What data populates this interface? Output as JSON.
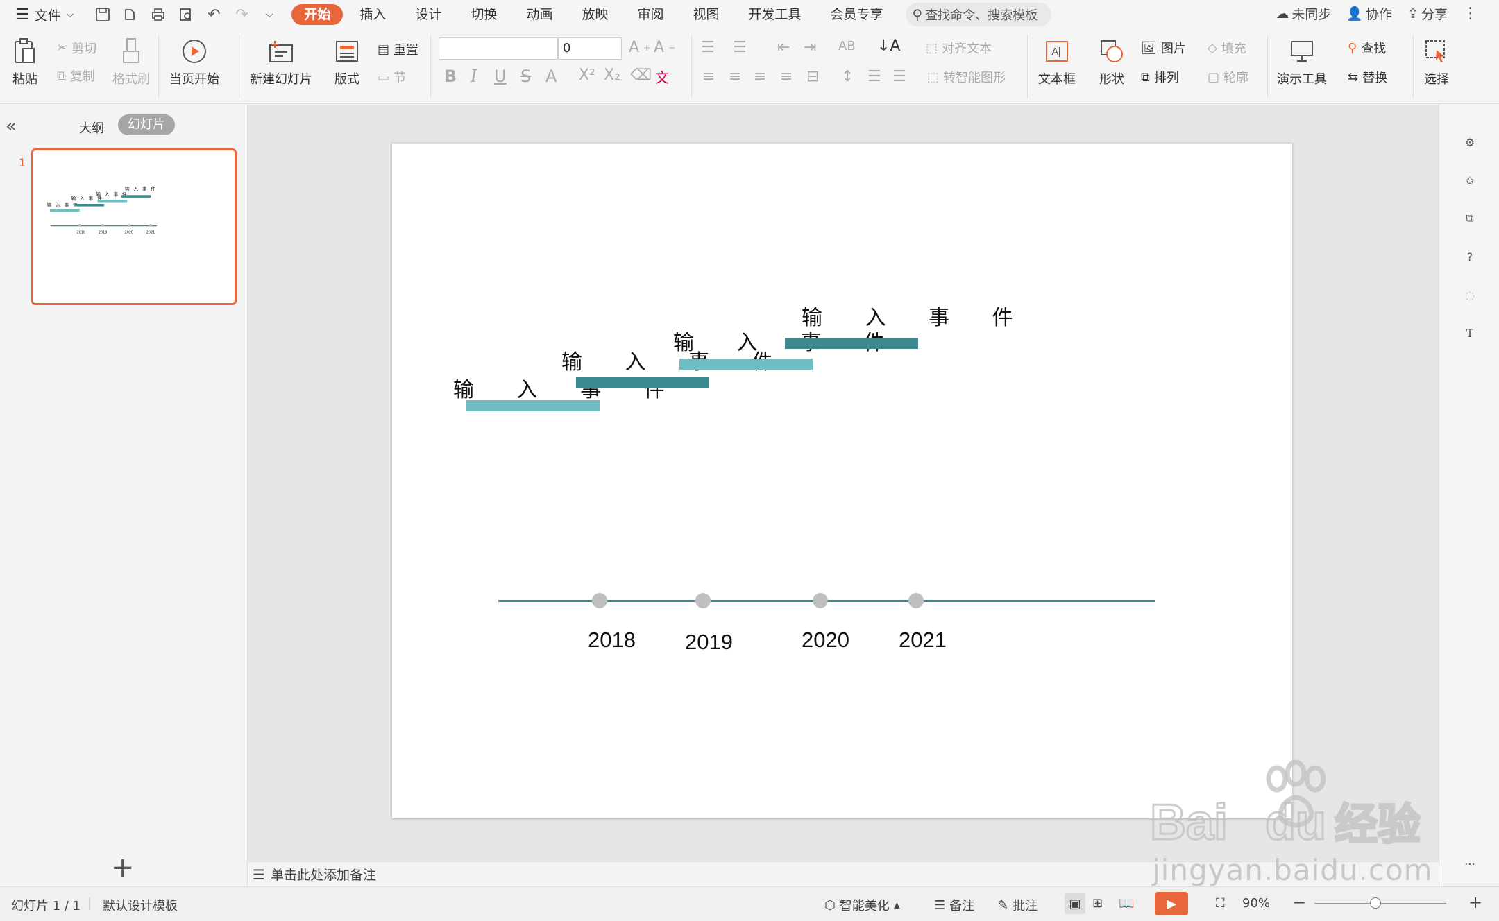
{
  "titlebar": {
    "menu_label": "文件",
    "tabs": [
      "开始",
      "插入",
      "设计",
      "切换",
      "动画",
      "放映",
      "审阅",
      "视图",
      "开发工具",
      "会员专享"
    ],
    "active_tab": "开始",
    "search_placeholder": "查找命令、搜索模板",
    "sync_label": "未同步",
    "collab_label": "协作",
    "share_label": "分享"
  },
  "ribbon": {
    "paste": "粘贴",
    "cut": "剪切",
    "copy": "复制",
    "format_painter": "格式刷",
    "from_current": "当页开始",
    "new_slide": "新建幻灯片",
    "layout": "版式",
    "reset": "重置",
    "section": "节",
    "font_name": "",
    "font_size": "0",
    "align_text": "对齐文本",
    "to_smartart": "转智能图形",
    "textbox": "文本框",
    "shape": "形状",
    "picture": "图片",
    "arrange": "排列",
    "fill": "填充",
    "outline": "轮廓",
    "present_tools": "演示工具",
    "find": "查找",
    "replace": "替换",
    "select": "选择"
  },
  "leftpanel": {
    "tab_outline": "大纲",
    "tab_slides": "幻灯片",
    "slide_number": "1"
  },
  "slide": {
    "events": [
      "输 入 事 件",
      "输 入 事 件",
      "输 入 事 件",
      "输 入 事 件"
    ],
    "years": [
      "2018",
      "2019",
      "2020",
      "2021"
    ],
    "colors": {
      "dark_teal": "#3b8a8f",
      "light_teal": "#6fbcc1",
      "dot_gray": "#bfbfbf"
    }
  },
  "notes": {
    "placeholder": "单击此处添加备注"
  },
  "status": {
    "slide_count": "幻灯片 1 / 1",
    "template": "默认设计模板",
    "smart_beautify": "智能美化",
    "notes": "备注",
    "comments": "批注",
    "zoom": "90%"
  },
  "watermark": {
    "text": "jingyan.baidu.com"
  },
  "accent_color": "#e8663c"
}
